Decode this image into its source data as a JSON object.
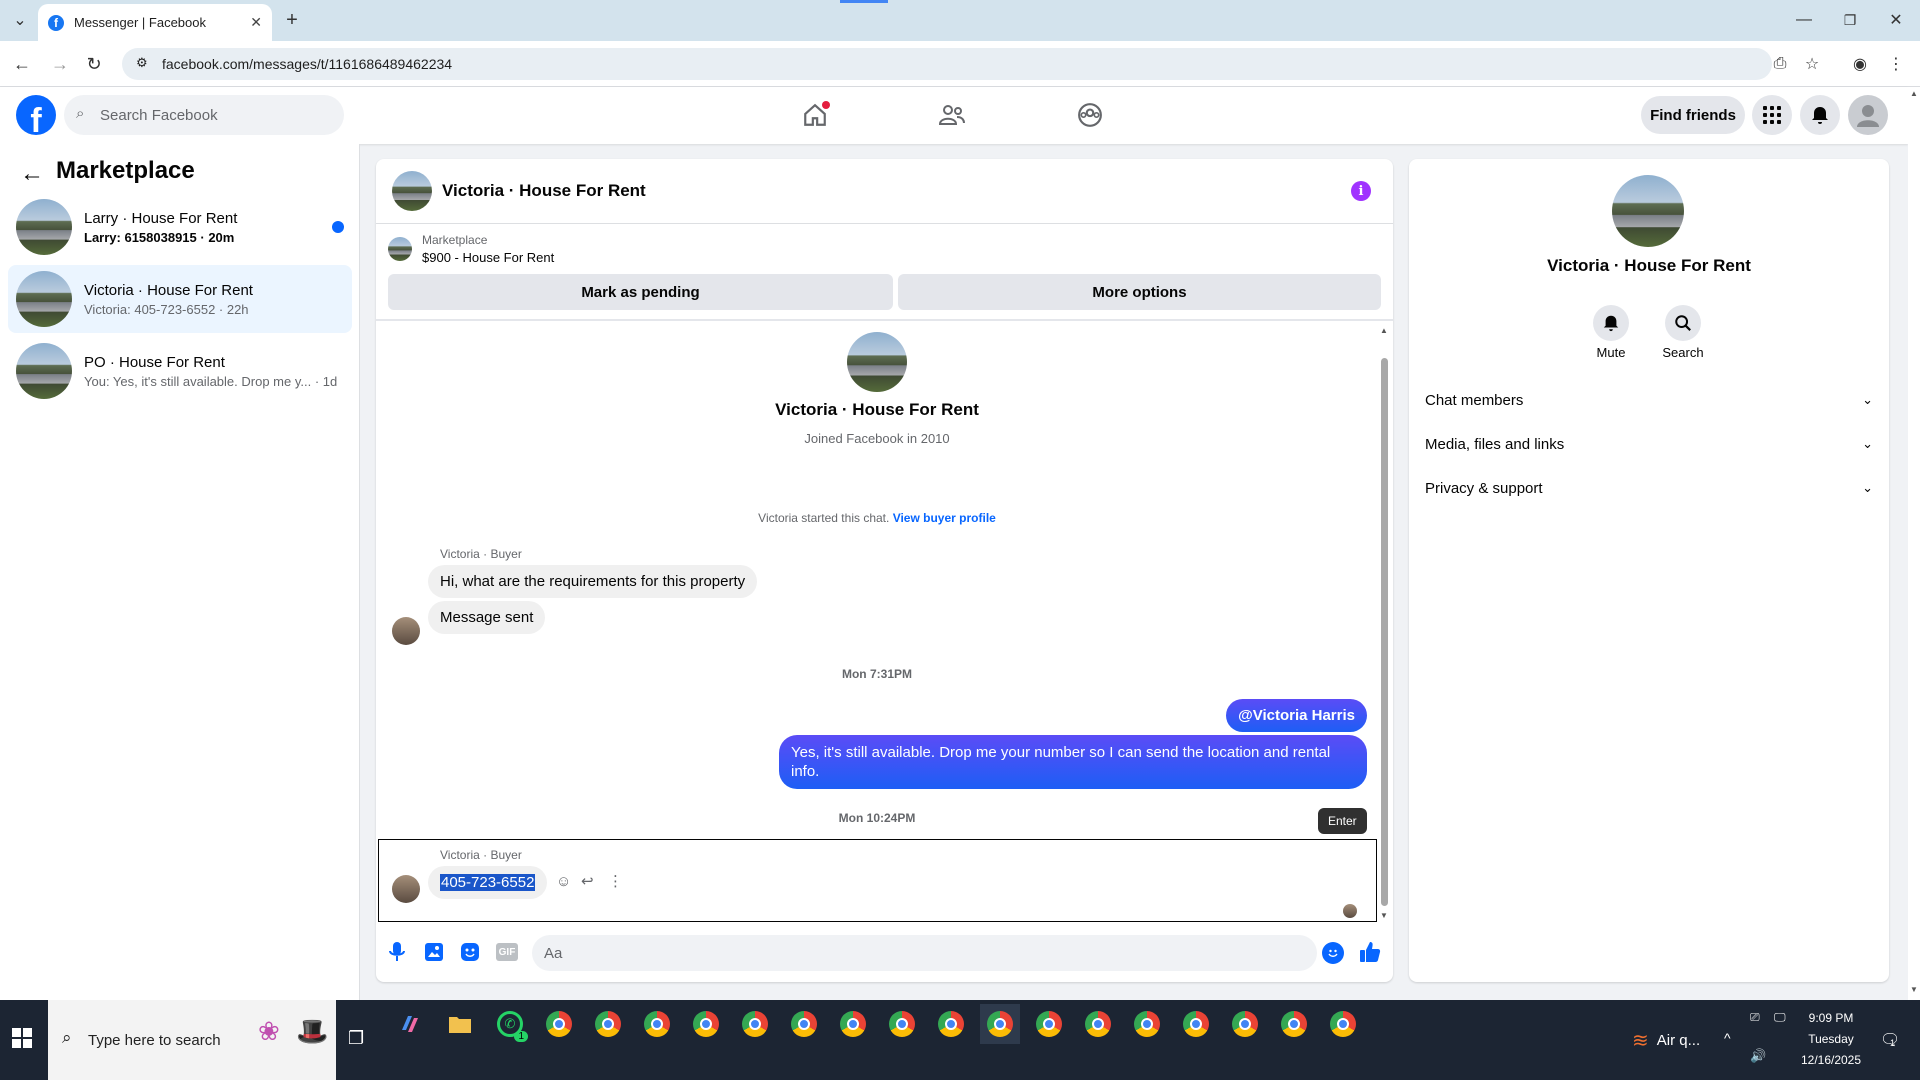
{
  "browser": {
    "tab_title": "Messenger | Facebook",
    "url": "facebook.com/messages/t/1161686489462234"
  },
  "header": {
    "search_placeholder": "Search Facebook",
    "find_friends": "Find friends"
  },
  "sidebar": {
    "title": "Marketplace",
    "conversations": [
      {
        "name": "Larry · House For Rent",
        "preview": "Larry: 6158038915 · 20m",
        "unread": true
      },
      {
        "name": "Victoria · House For Rent",
        "preview": "Victoria: 405-723-6552 · 22h",
        "active": true
      },
      {
        "name": "PO · House For Rent",
        "preview": "You: Yes, it's still available. Drop me y... · 1d"
      }
    ]
  },
  "chat": {
    "title": "Victoria · House For Rent",
    "listing_label": "Marketplace",
    "listing_title": "$900 - House For Rent",
    "mark_pending": "Mark as pending",
    "more_options": "More options",
    "profile_name": "Victoria · House For Rent",
    "joined": "Joined Facebook in 2010",
    "started_text": "Victoria started this chat.",
    "view_buyer": "View buyer profile",
    "sender_label": "Victoria · Buyer",
    "msg1": "Hi, what are the requirements for this property",
    "msg2": "Message sent",
    "time1": "Mon 7:31PM",
    "out_mention": "@Victoria Harris",
    "out_msg": "Yes, it's still available. Drop me your number so I can send the location and rental info.",
    "time2": "Mon 10:24PM",
    "tooltip": "Enter",
    "sender_label2": "Victoria · Buyer",
    "msg3": "405-723-6552",
    "composer_placeholder": "Aa"
  },
  "right_panel": {
    "name": "Victoria · House For Rent",
    "mute": "Mute",
    "search": "Search",
    "sections": [
      "Chat members",
      "Media, files and links",
      "Privacy & support"
    ]
  },
  "taskbar": {
    "search_placeholder": "Type here to search",
    "weather": "Air q...",
    "time": "9:09 PM",
    "day": "Tuesday",
    "date": "12/16/2025",
    "whatsapp_badge": "1",
    "notif_badge": "1"
  },
  "colors": {
    "fb_blue": "#0866ff",
    "info_purple": "#a033ff"
  }
}
